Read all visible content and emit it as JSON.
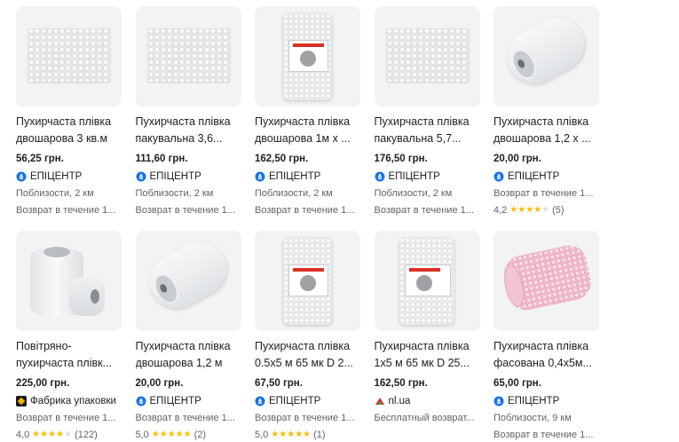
{
  "products": [
    {
      "title": "Пухирчаста плівка двошарова 3 кв.м",
      "price": "56,25 грн.",
      "merchant": "ЕПІЦЕНТР",
      "merchant_icon": "epicentr-icon",
      "line1": "Поблизости, 2 км",
      "line2": "Возврат в течение 1..."
    },
    {
      "title": "Пухирчаста плівка пакувальна 3,6...",
      "price": "111,60 грн.",
      "merchant": "ЕПІЦЕНТР",
      "merchant_icon": "epicentr-icon",
      "line1": "Поблизости, 2 км",
      "line2": "Возврат в течение 1..."
    },
    {
      "title": "Пухирчаста плівка двошарова 1м х ...",
      "price": "162,50 грн.",
      "merchant": "ЕПІЦЕНТР",
      "merchant_icon": "epicentr-icon",
      "line1": "Поблизости, 2 км",
      "line2": "Возврат в течение 1..."
    },
    {
      "title": "Пухирчаста плівка пакувальна 5,7...",
      "price": "176,50 грн.",
      "merchant": "ЕПІЦЕНТР",
      "merchant_icon": "epicentr-icon",
      "line1": "Поблизости, 2 км",
      "line2": "Возврат в течение 1..."
    },
    {
      "title": "Пухирчаста плівка двошарова 1,2 х ...",
      "price": "20,00 грн.",
      "merchant": "ЕПІЦЕНТР",
      "merchant_icon": "epicentr-icon",
      "line1": "Возврат в течение 1...",
      "rating": {
        "value": "4,2",
        "stars": 4,
        "count": "(5)"
      }
    },
    {
      "title": "Повітряно-пухирчаста плівк...",
      "price": "225,00 грн.",
      "merchant": "Фабрика упаковки",
      "merchant_icon": "fabrika-icon",
      "line1": "Возврат в течение 1...",
      "rating": {
        "value": "4,0",
        "stars": 4,
        "count": "(122)"
      }
    },
    {
      "title": "Пухирчаста плівка двошарова 1,2 м",
      "price": "20,00 грн.",
      "merchant": "ЕПІЦЕНТР",
      "merchant_icon": "epicentr-icon",
      "line1": "Возврат в течение 1...",
      "rating": {
        "value": "5,0",
        "stars": 5,
        "count": "(2)"
      }
    },
    {
      "title": "Пухирчаста плівка 0.5х5 м 65 мк D 2...",
      "price": "67,50 грн.",
      "merchant": "ЕПІЦЕНТР",
      "merchant_icon": "epicentr-icon",
      "line1": "Возврат в течение 1...",
      "rating": {
        "value": "5,0",
        "stars": 5,
        "count": "(1)"
      }
    },
    {
      "title": "Пухирчаста плівка 1х5 м 65 мк D 25...",
      "price": "162,50 грн.",
      "merchant": "nl.ua",
      "merchant_icon": "nl-ua-icon",
      "line1": "Бесплатный возврат..."
    },
    {
      "title": "Пухирчаста плівка фасована 0,4х5м...",
      "price": "65,00 грн.",
      "merchant": "ЕПІЦЕНТР",
      "merchant_icon": "epicentr-icon",
      "line1": "Поблизости, 9 км",
      "line2": "Возврат в течение 1..."
    }
  ],
  "colors": {
    "star": "#fbbc04",
    "price_text": "#202124",
    "meta_text": "#5f6368",
    "epicentr_blue": "#1a73e8"
  }
}
